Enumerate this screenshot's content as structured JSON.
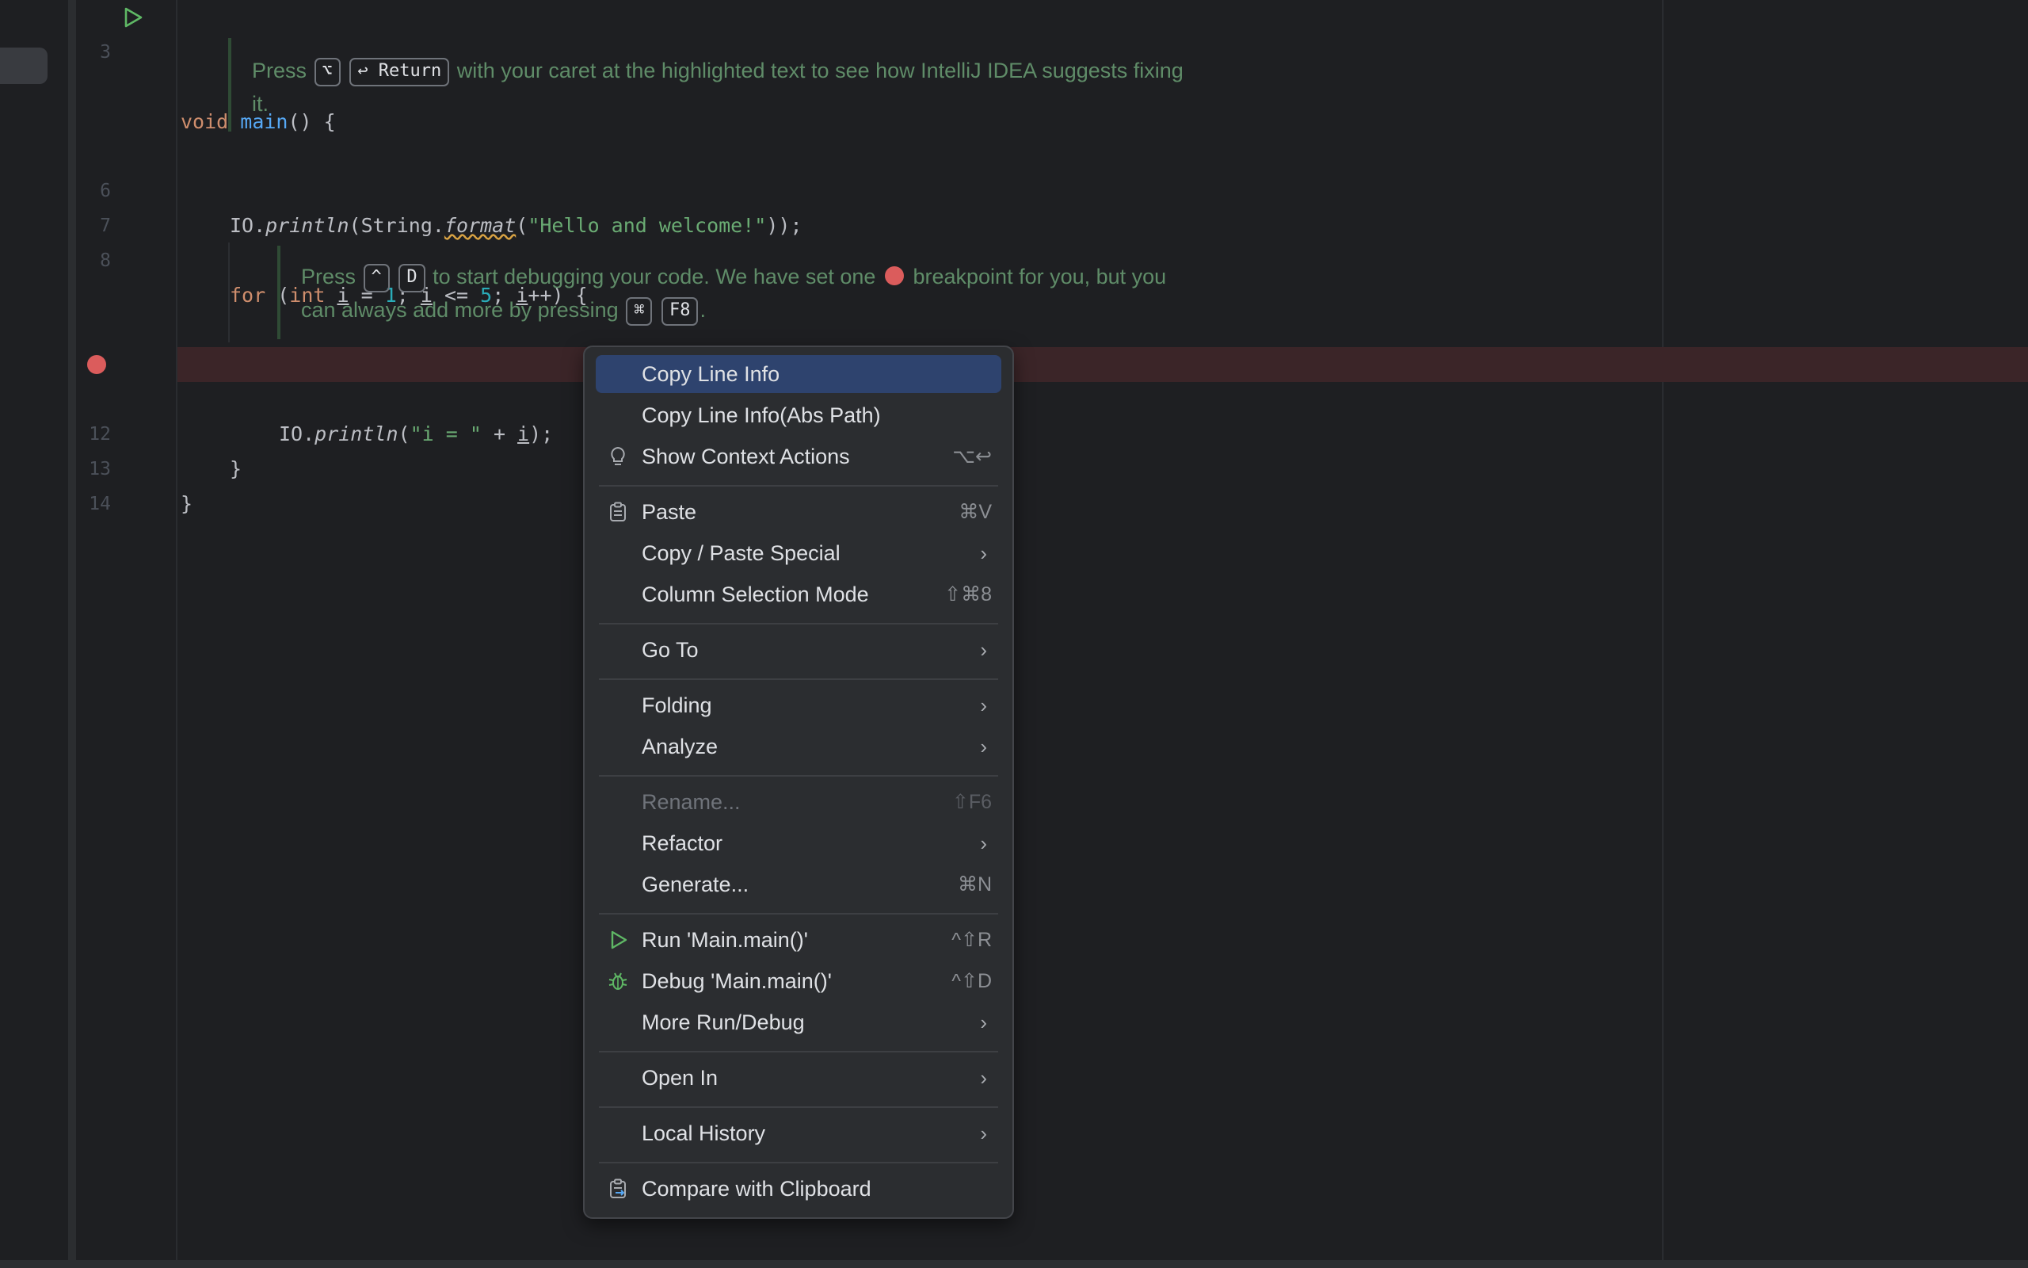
{
  "editor": {
    "lines": [
      {
        "num": "3",
        "code": "void main() {"
      },
      {
        "num": "6",
        "code": "IO.println(String.format(\"Hello and welcome!\"));"
      },
      {
        "num": "7",
        "code": ""
      },
      {
        "num": "8",
        "code": "for (int i = 1; i <= 5; i++) {"
      },
      {
        "num": "",
        "code": "IO.println(\"i = \" + i);"
      },
      {
        "num": "12",
        "code": "}"
      },
      {
        "num": "13",
        "code": "}"
      },
      {
        "num": "14",
        "code": ""
      }
    ],
    "tips": {
      "tip1": {
        "t1": "Press",
        "key1": "⌥",
        "key2": "↩ Return",
        "t2": "with your caret at the highlighted text to see how IntelliJ IDEA suggests fixing",
        "t3": "it."
      },
      "tip2": {
        "t1": "Press",
        "key1": "^",
        "key2": "D",
        "t2": "to start debugging your code. We have set one",
        "t3": "breakpoint for you, but you",
        "t4": "can always add more by pressing",
        "key3": "⌘",
        "key4": "F8",
        "t5": "."
      }
    }
  },
  "context_menu": {
    "items": [
      {
        "label": "Copy Line Info",
        "shortcut": "",
        "selected": true
      },
      {
        "label": "Copy Line Info(Abs Path)",
        "shortcut": ""
      },
      {
        "label": "Show Context Actions",
        "shortcut": "⌥↩",
        "icon": "lightbulb-icon"
      },
      {
        "label": "Paste",
        "shortcut": "⌘V",
        "icon": "clipboard-icon"
      },
      {
        "label": "Copy / Paste Special",
        "submenu": true
      },
      {
        "label": "Column Selection Mode",
        "shortcut": "⇧⌘8"
      },
      {
        "label": "Go To",
        "submenu": true
      },
      {
        "label": "Folding",
        "submenu": true
      },
      {
        "label": "Analyze",
        "submenu": true
      },
      {
        "label": "Rename...",
        "shortcut": "⇧F6",
        "disabled": true
      },
      {
        "label": "Refactor",
        "submenu": true
      },
      {
        "label": "Generate...",
        "shortcut": "⌘N"
      },
      {
        "label": "Run 'Main.main()'",
        "shortcut": "^⇧R",
        "icon": "run-icon"
      },
      {
        "label": "Debug 'Main.main()'",
        "shortcut": "^⇧D",
        "icon": "bug-icon"
      },
      {
        "label": "More Run/Debug",
        "submenu": true
      },
      {
        "label": "Open In",
        "submenu": true
      },
      {
        "label": "Local History",
        "submenu": true
      },
      {
        "label": "Compare with Clipboard",
        "icon": "compare-clipboard-icon"
      }
    ],
    "chevron": "›"
  },
  "colors": {
    "background": "#1e1f22",
    "menu_bg": "#2b2d30",
    "selection": "#2e436e",
    "breakpoint": "#db5c5c",
    "breakpoint_row": "#3b2528",
    "tip_text": "#5f8c68",
    "keyword": "#cf8e6d",
    "function": "#56a8f5",
    "string": "#6aab73",
    "number": "#2aacb8"
  }
}
